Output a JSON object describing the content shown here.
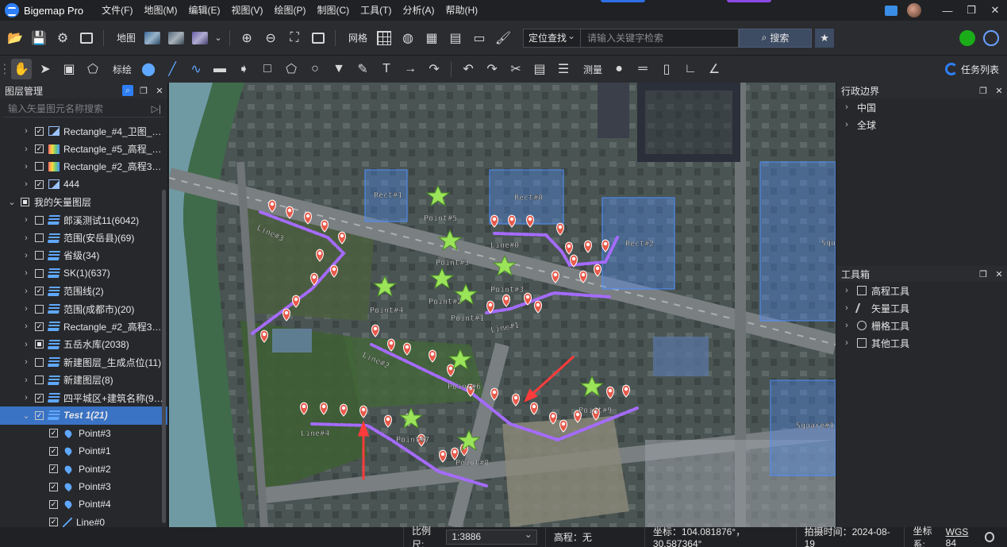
{
  "app": {
    "name": "Bigemap Pro",
    "menu": [
      "文件(F)",
      "地图(M)",
      "编辑(E)",
      "视图(V)",
      "绘图(P)",
      "制图(C)",
      "工具(T)",
      "分析(A)",
      "帮助(H)"
    ]
  },
  "toolbar1": {
    "map_label": "地图",
    "grid_label": "网格",
    "search_mode": "定位查找",
    "search_placeholder": "请输入关键字检索",
    "search_button": "搜索"
  },
  "toolbar2": {
    "annotate_label": "标绘",
    "measure_label": "测量",
    "task_list": "任务列表"
  },
  "layer_panel": {
    "title": "图层管理",
    "search_placeholder": "输入矢量图元名称搜索",
    "rows": [
      {
        "indent": 1,
        "expand": "›",
        "check": "checked",
        "icon": "img",
        "label": "Rectangle_#4_卫图_Le..."
      },
      {
        "indent": 1,
        "expand": "›",
        "check": "checked",
        "icon": "rainbow",
        "label": "Rectangle_#5_高程_Le..."
      },
      {
        "indent": 1,
        "expand": "›",
        "check": "none",
        "icon": "rainbow",
        "label": "Rectangle_#2_高程33_..."
      },
      {
        "indent": 1,
        "expand": "›",
        "check": "checked",
        "icon": "img",
        "label": "444"
      },
      {
        "indent": 0,
        "expand": "⌄",
        "check": "partial",
        "icon": "",
        "label": "我的矢量图层"
      },
      {
        "indent": 1,
        "expand": "›",
        "check": "none",
        "icon": "stack",
        "label": "郎溪测试11(6042)"
      },
      {
        "indent": 1,
        "expand": "›",
        "check": "none",
        "icon": "stack",
        "label": "范围(安岳县)(69)"
      },
      {
        "indent": 1,
        "expand": "›",
        "check": "none",
        "icon": "stack",
        "label": "省级(34)"
      },
      {
        "indent": 1,
        "expand": "›",
        "check": "none",
        "icon": "stack",
        "label": "SK(1)(637)"
      },
      {
        "indent": 1,
        "expand": "›",
        "check": "checked",
        "icon": "stack",
        "label": "范围线(2)"
      },
      {
        "indent": 1,
        "expand": "›",
        "check": "none",
        "icon": "stack",
        "label": "范围(成都市)(20)"
      },
      {
        "indent": 1,
        "expand": "›",
        "check": "checked",
        "icon": "stack",
        "label": "Rectangle_#2_高程33_..."
      },
      {
        "indent": 1,
        "expand": "›",
        "check": "partial",
        "icon": "stack",
        "label": "五岳水库(2038)"
      },
      {
        "indent": 1,
        "expand": "›",
        "check": "none",
        "icon": "stack",
        "label": "新建图层_生成点位(11)"
      },
      {
        "indent": 1,
        "expand": "›",
        "check": "none",
        "icon": "stack",
        "label": "新建图层(8)"
      },
      {
        "indent": 1,
        "expand": "›",
        "check": "checked",
        "icon": "stack",
        "label": "四平城区+建筑名称(97..."
      },
      {
        "indent": 1,
        "expand": "⌄",
        "check": "checked",
        "icon": "stack",
        "label": "Test 1(21)",
        "selected": true
      },
      {
        "indent": 2,
        "expand": "",
        "check": "checked",
        "icon": "pin",
        "label": "Point#3"
      },
      {
        "indent": 2,
        "expand": "",
        "check": "checked",
        "icon": "pin",
        "label": "Point#1"
      },
      {
        "indent": 2,
        "expand": "",
        "check": "checked",
        "icon": "pin",
        "label": "Point#2"
      },
      {
        "indent": 2,
        "expand": "",
        "check": "checked",
        "icon": "pin",
        "label": "Point#3"
      },
      {
        "indent": 2,
        "expand": "",
        "check": "checked",
        "icon": "pin",
        "label": "Point#4"
      },
      {
        "indent": 2,
        "expand": "",
        "check": "checked",
        "icon": "line",
        "label": "Line#0"
      }
    ]
  },
  "map": {
    "labels": [
      "Rect#1",
      "Rect#0",
      "Rect#2",
      "Point#5",
      "Point#3",
      "Point#3",
      "Point#2",
      "Point#1",
      "Point#4",
      "Point#6",
      "Point#7",
      "Point#8",
      "Point#9",
      "Line#0",
      "Line#1",
      "Line#2",
      "Line#3",
      "Line#4",
      "Square#1",
      "Squ"
    ],
    "colors": {
      "rect": "#4d8fff",
      "line": "#a56bff",
      "star": "#9be45a",
      "pin": "#e8594a",
      "arrow": "#ff3b3b"
    }
  },
  "right_panel": {
    "admin_title": "行政边界",
    "admin_items": [
      "中国",
      "全球"
    ],
    "toolbox_title": "工具箱",
    "tools": [
      "高程工具",
      "矢量工具",
      "栅格工具",
      "其他工具"
    ]
  },
  "status": {
    "scale_label": "比例尺:",
    "scale_value": "1:3886",
    "elevation": "高程：无",
    "coords": "坐标：104.081876°，30.587364°",
    "capture_time": "拍摄时间：2024-08-19",
    "crs_label": "坐标系:",
    "crs_value": "WGS 84"
  }
}
